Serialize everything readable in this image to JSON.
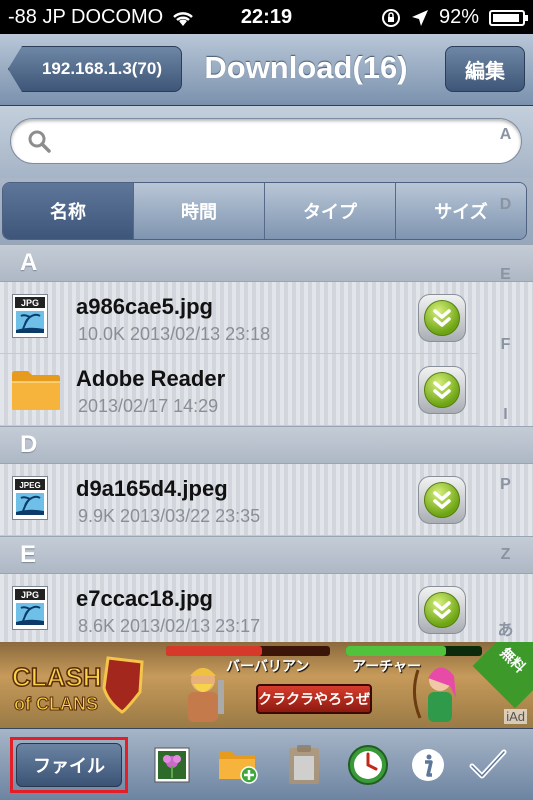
{
  "status_bar": {
    "carrier": "-88 JP DOCOMO",
    "time": "22:19",
    "battery": "92%"
  },
  "nav": {
    "back_label": "192.168.1.3(70)",
    "title": "Download(16)",
    "edit_label": "編集"
  },
  "search": {
    "placeholder": "",
    "value": ""
  },
  "sort_tabs": [
    "名称",
    "時間",
    "タイプ",
    "サイズ"
  ],
  "sections": [
    {
      "header": "A",
      "rows": [
        {
          "name": "a986cae5.jpg",
          "meta": "10.0K 2013/02/13 23:18",
          "icon": "jpg-file-icon",
          "badge": "JPG"
        },
        {
          "name": "Adobe Reader",
          "meta": " 2013/02/17 14:29",
          "icon": "folder-icon",
          "badge": ""
        }
      ]
    },
    {
      "header": "D",
      "rows": [
        {
          "name": "d9a165d4.jpeg",
          "meta": "9.9K 2013/03/22 23:35",
          "icon": "jpeg-file-icon",
          "badge": "JPEG"
        }
      ]
    },
    {
      "header": "E",
      "rows": [
        {
          "name": "e7ccac18.jpg",
          "meta": "8.6K 2013/02/13 23:17",
          "icon": "jpg-file-icon",
          "badge": "JPG"
        }
      ]
    }
  ],
  "index_bar": [
    "A",
    "D",
    "E",
    "F",
    "I",
    "P",
    "Z",
    "あ"
  ],
  "ad": {
    "logo_line1": "CLASH",
    "logo_line2": "of CLANS",
    "label_barbarian": "バーバリアン",
    "label_archer": "アーチャー",
    "cta": "クラクラやろうぜ",
    "free": "無料",
    "iad": "iAd"
  },
  "toolbar": {
    "file_label": "ファイル",
    "icons": [
      "photo-library-icon",
      "new-folder-icon",
      "paste-icon",
      "clock-icon",
      "info-icon",
      "checkmark-icon"
    ]
  },
  "colors": {
    "nav_gradient_top": "#b9c7d8",
    "nav_gradient_bottom": "#7a91ad",
    "download_green": "#6da414",
    "highlight_red": "#e41e26"
  }
}
